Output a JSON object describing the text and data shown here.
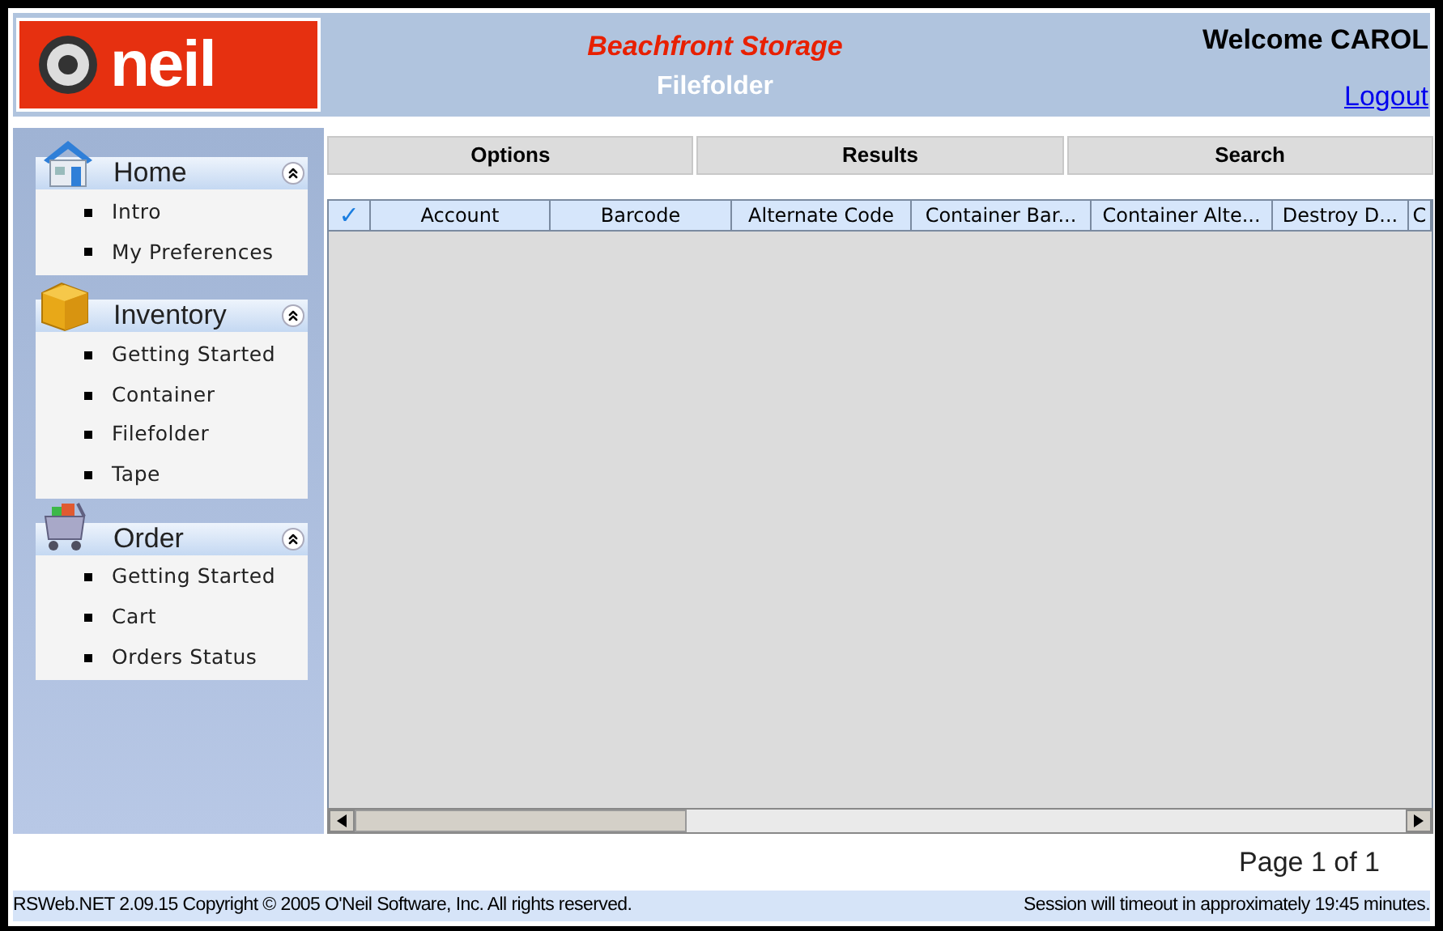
{
  "header": {
    "logo_text": "neil",
    "company": "Beachfront Storage",
    "page": "Filefolder",
    "welcome": "Welcome CAROL",
    "logout": "Logout"
  },
  "sidebar": {
    "sections": [
      {
        "kind": "house",
        "title": "Home",
        "expanded": true,
        "items": [
          "Intro",
          "My Preferences"
        ]
      },
      {
        "kind": "box",
        "title": "Inventory",
        "expanded": true,
        "items": [
          "Getting Started",
          "Container",
          "Filefolder",
          "Tape"
        ]
      },
      {
        "kind": "cart",
        "title": "Order",
        "expanded": true,
        "items": [
          "Getting Started",
          "Cart",
          "Orders Status"
        ]
      }
    ]
  },
  "tabs": [
    {
      "label": "Options",
      "selected": false
    },
    {
      "label": "Results",
      "selected": false
    },
    {
      "label": "Search",
      "selected": false
    }
  ],
  "table": {
    "check_column": "✓",
    "columns": [
      "Account",
      "Barcode",
      "Alternate Code",
      "Container Bar...",
      "Container Alte...",
      "Destroy D...",
      "C"
    ]
  },
  "pager": "Page 1 of 1",
  "status_bar": {
    "copyright": "RSWeb.NET 2.09.15 Copyright © 2005 O'Neil Software, Inc. All rights reserved.",
    "session": "Session will timeout in approximately 19:45 minutes."
  }
}
